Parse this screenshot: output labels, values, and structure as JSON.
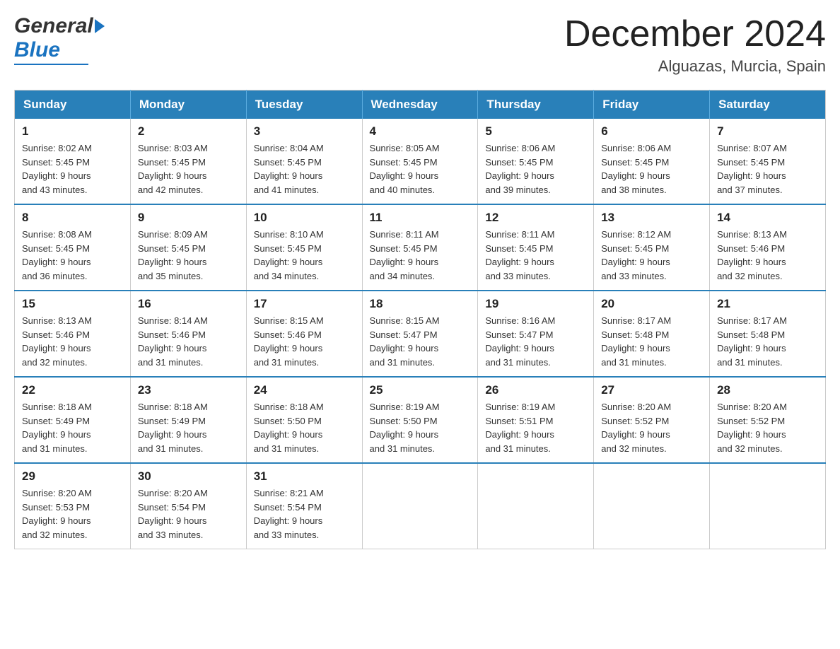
{
  "header": {
    "logo_general": "General",
    "logo_blue": "Blue",
    "month_title": "December 2024",
    "location": "Alguazas, Murcia, Spain"
  },
  "weekdays": [
    "Sunday",
    "Monday",
    "Tuesday",
    "Wednesday",
    "Thursday",
    "Friday",
    "Saturday"
  ],
  "weeks": [
    [
      {
        "day": "1",
        "sunrise": "8:02 AM",
        "sunset": "5:45 PM",
        "daylight": "9 hours and 43 minutes."
      },
      {
        "day": "2",
        "sunrise": "8:03 AM",
        "sunset": "5:45 PM",
        "daylight": "9 hours and 42 minutes."
      },
      {
        "day": "3",
        "sunrise": "8:04 AM",
        "sunset": "5:45 PM",
        "daylight": "9 hours and 41 minutes."
      },
      {
        "day": "4",
        "sunrise": "8:05 AM",
        "sunset": "5:45 PM",
        "daylight": "9 hours and 40 minutes."
      },
      {
        "day": "5",
        "sunrise": "8:06 AM",
        "sunset": "5:45 PM",
        "daylight": "9 hours and 39 minutes."
      },
      {
        "day": "6",
        "sunrise": "8:06 AM",
        "sunset": "5:45 PM",
        "daylight": "9 hours and 38 minutes."
      },
      {
        "day": "7",
        "sunrise": "8:07 AM",
        "sunset": "5:45 PM",
        "daylight": "9 hours and 37 minutes."
      }
    ],
    [
      {
        "day": "8",
        "sunrise": "8:08 AM",
        "sunset": "5:45 PM",
        "daylight": "9 hours and 36 minutes."
      },
      {
        "day": "9",
        "sunrise": "8:09 AM",
        "sunset": "5:45 PM",
        "daylight": "9 hours and 35 minutes."
      },
      {
        "day": "10",
        "sunrise": "8:10 AM",
        "sunset": "5:45 PM",
        "daylight": "9 hours and 34 minutes."
      },
      {
        "day": "11",
        "sunrise": "8:11 AM",
        "sunset": "5:45 PM",
        "daylight": "9 hours and 34 minutes."
      },
      {
        "day": "12",
        "sunrise": "8:11 AM",
        "sunset": "5:45 PM",
        "daylight": "9 hours and 33 minutes."
      },
      {
        "day": "13",
        "sunrise": "8:12 AM",
        "sunset": "5:45 PM",
        "daylight": "9 hours and 33 minutes."
      },
      {
        "day": "14",
        "sunrise": "8:13 AM",
        "sunset": "5:46 PM",
        "daylight": "9 hours and 32 minutes."
      }
    ],
    [
      {
        "day": "15",
        "sunrise": "8:13 AM",
        "sunset": "5:46 PM",
        "daylight": "9 hours and 32 minutes."
      },
      {
        "day": "16",
        "sunrise": "8:14 AM",
        "sunset": "5:46 PM",
        "daylight": "9 hours and 31 minutes."
      },
      {
        "day": "17",
        "sunrise": "8:15 AM",
        "sunset": "5:46 PM",
        "daylight": "9 hours and 31 minutes."
      },
      {
        "day": "18",
        "sunrise": "8:15 AM",
        "sunset": "5:47 PM",
        "daylight": "9 hours and 31 minutes."
      },
      {
        "day": "19",
        "sunrise": "8:16 AM",
        "sunset": "5:47 PM",
        "daylight": "9 hours and 31 minutes."
      },
      {
        "day": "20",
        "sunrise": "8:17 AM",
        "sunset": "5:48 PM",
        "daylight": "9 hours and 31 minutes."
      },
      {
        "day": "21",
        "sunrise": "8:17 AM",
        "sunset": "5:48 PM",
        "daylight": "9 hours and 31 minutes."
      }
    ],
    [
      {
        "day": "22",
        "sunrise": "8:18 AM",
        "sunset": "5:49 PM",
        "daylight": "9 hours and 31 minutes."
      },
      {
        "day": "23",
        "sunrise": "8:18 AM",
        "sunset": "5:49 PM",
        "daylight": "9 hours and 31 minutes."
      },
      {
        "day": "24",
        "sunrise": "8:18 AM",
        "sunset": "5:50 PM",
        "daylight": "9 hours and 31 minutes."
      },
      {
        "day": "25",
        "sunrise": "8:19 AM",
        "sunset": "5:50 PM",
        "daylight": "9 hours and 31 minutes."
      },
      {
        "day": "26",
        "sunrise": "8:19 AM",
        "sunset": "5:51 PM",
        "daylight": "9 hours and 31 minutes."
      },
      {
        "day": "27",
        "sunrise": "8:20 AM",
        "sunset": "5:52 PM",
        "daylight": "9 hours and 32 minutes."
      },
      {
        "day": "28",
        "sunrise": "8:20 AM",
        "sunset": "5:52 PM",
        "daylight": "9 hours and 32 minutes."
      }
    ],
    [
      {
        "day": "29",
        "sunrise": "8:20 AM",
        "sunset": "5:53 PM",
        "daylight": "9 hours and 32 minutes."
      },
      {
        "day": "30",
        "sunrise": "8:20 AM",
        "sunset": "5:54 PM",
        "daylight": "9 hours and 33 minutes."
      },
      {
        "day": "31",
        "sunrise": "8:21 AM",
        "sunset": "5:54 PM",
        "daylight": "9 hours and 33 minutes."
      },
      null,
      null,
      null,
      null
    ]
  ],
  "labels": {
    "sunrise": "Sunrise:",
    "sunset": "Sunset:",
    "daylight": "Daylight:"
  }
}
